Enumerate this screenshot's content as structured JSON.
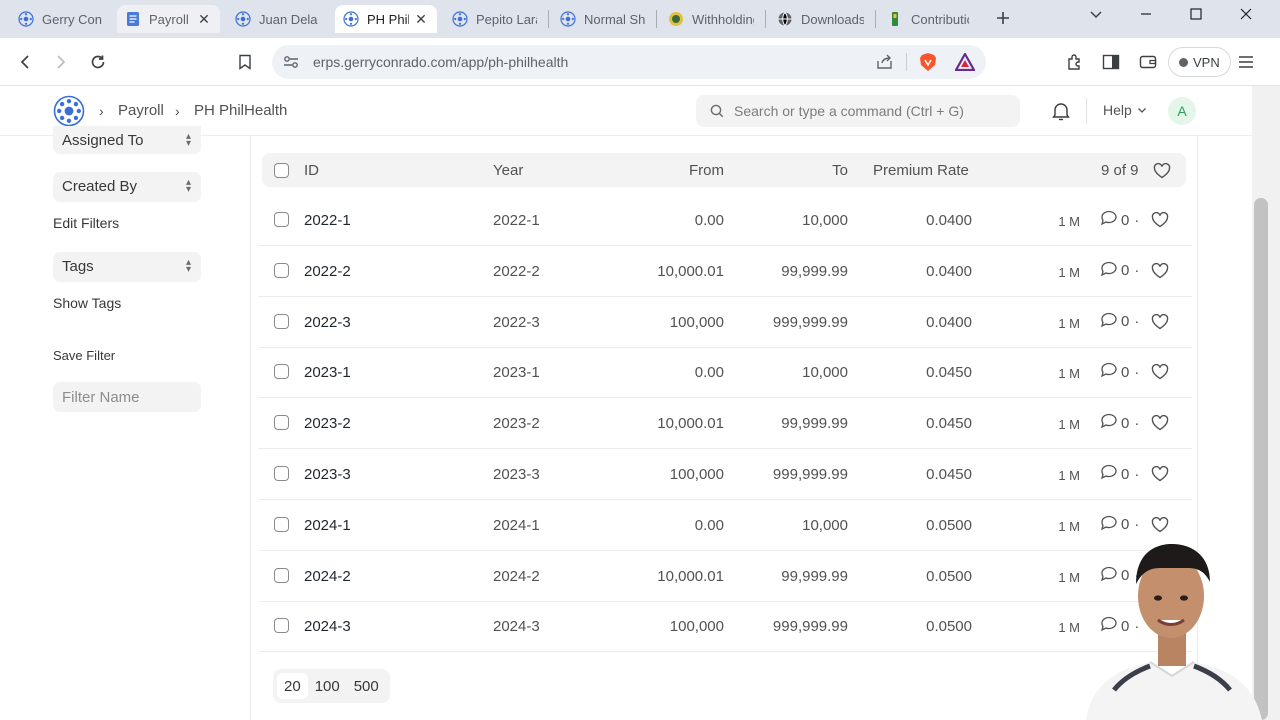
{
  "browser": {
    "tabs": [
      {
        "title": "Gerry Conrado",
        "icon": "frappe-icon",
        "state": "normal"
      },
      {
        "title": "Payroll",
        "icon": "document-icon",
        "state": "hover"
      },
      {
        "title": "Juan Dela Cruz",
        "icon": "frappe-icon",
        "state": "normal"
      },
      {
        "title": "PH PhilHealth",
        "icon": "frappe-icon",
        "state": "active"
      },
      {
        "title": "Pepito Laranjo",
        "icon": "frappe-icon",
        "state": "normal"
      },
      {
        "title": "Normal Shift",
        "icon": "frappe-icon",
        "state": "normal"
      },
      {
        "title": "Withholding Tax",
        "icon": "bir-icon",
        "state": "normal"
      },
      {
        "title": "Downloads",
        "icon": "globe-icon",
        "state": "normal"
      },
      {
        "title": "Contributions",
        "icon": "pagibig-icon",
        "state": "normal"
      }
    ],
    "url": "erps.gerryconrado.com/app/ph-philhealth",
    "vpn_label": "VPN"
  },
  "navbar": {
    "breadcrumb": [
      "Payroll",
      "PH PhilHealth"
    ],
    "search_placeholder": "Search or type a command (Ctrl + G)",
    "help_label": "Help",
    "avatar_initial": "A"
  },
  "sidebar": {
    "assigned_to": "Assigned To",
    "created_by": "Created By",
    "edit_filters": "Edit Filters",
    "tags": "Tags",
    "show_tags": "Show Tags",
    "save_filter": "Save Filter",
    "filter_name_placeholder": "Filter Name"
  },
  "list": {
    "headers": {
      "id": "ID",
      "year": "Year",
      "from": "From",
      "to": "To",
      "rate": "Premium Rate"
    },
    "count": "9 of 9",
    "rows": [
      {
        "id": "2022-1",
        "year": "2022-1",
        "from": "0.00",
        "to": "10,000",
        "rate": "0.0400",
        "modified": "1 M",
        "comments": "0"
      },
      {
        "id": "2022-2",
        "year": "2022-2",
        "from": "10,000.01",
        "to": "99,999.99",
        "rate": "0.0400",
        "modified": "1 M",
        "comments": "0"
      },
      {
        "id": "2022-3",
        "year": "2022-3",
        "from": "100,000",
        "to": "999,999.99",
        "rate": "0.0400",
        "modified": "1 M",
        "comments": "0"
      },
      {
        "id": "2023-1",
        "year": "2023-1",
        "from": "0.00",
        "to": "10,000",
        "rate": "0.0450",
        "modified": "1 M",
        "comments": "0"
      },
      {
        "id": "2023-2",
        "year": "2023-2",
        "from": "10,000.01",
        "to": "99,999.99",
        "rate": "0.0450",
        "modified": "1 M",
        "comments": "0"
      },
      {
        "id": "2023-3",
        "year": "2023-3",
        "from": "100,000",
        "to": "999,999.99",
        "rate": "0.0450",
        "modified": "1 M",
        "comments": "0"
      },
      {
        "id": "2024-1",
        "year": "2024-1",
        "from": "0.00",
        "to": "10,000",
        "rate": "0.0500",
        "modified": "1 M",
        "comments": "0"
      },
      {
        "id": "2024-2",
        "year": "2024-2",
        "from": "10,000.01",
        "to": "99,999.99",
        "rate": "0.0500",
        "modified": "1 M",
        "comments": "0"
      },
      {
        "id": "2024-3",
        "year": "2024-3",
        "from": "100,000",
        "to": "999,999.99",
        "rate": "0.0500",
        "modified": "1 M",
        "comments": "0"
      }
    ],
    "page_sizes": [
      "20",
      "100",
      "500"
    ]
  },
  "colors": {
    "accent_green": "#2f9e58",
    "frappe_blue": "#3b6fd8",
    "brave_orange": "#fb542b"
  }
}
